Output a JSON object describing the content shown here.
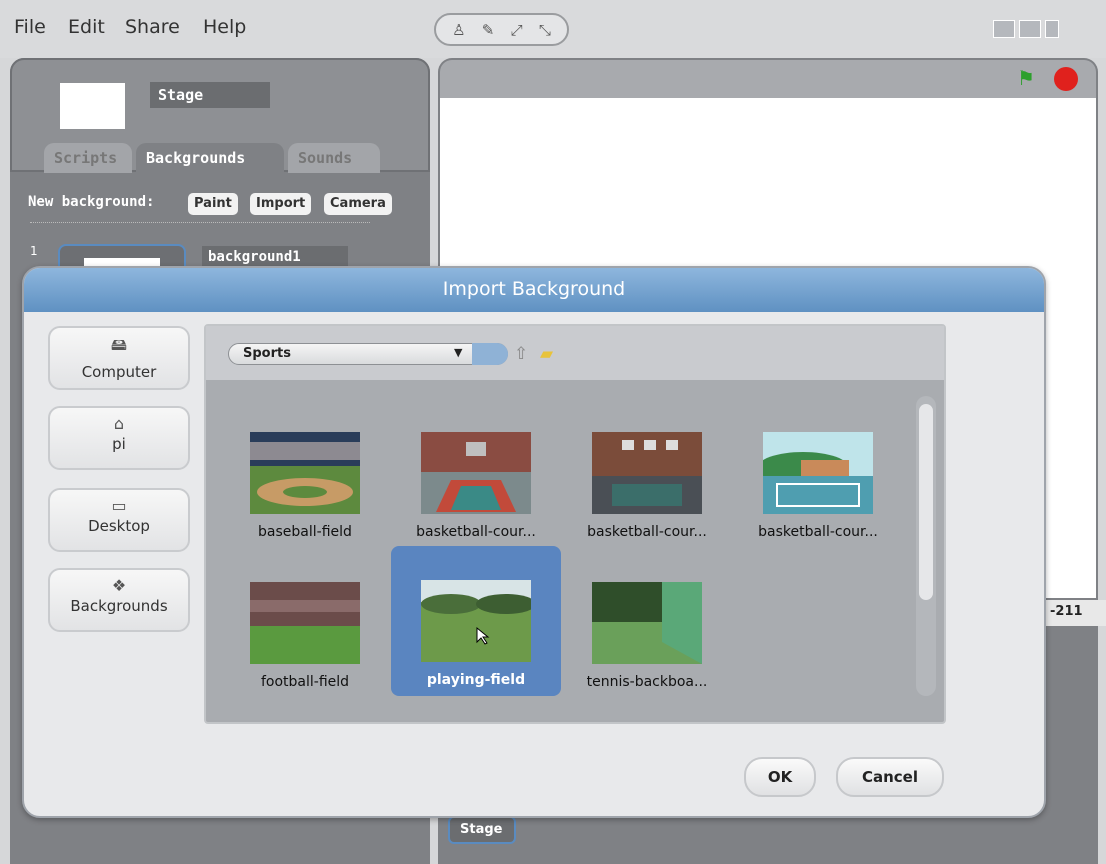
{
  "menu": [
    "File",
    "Edit",
    "Share",
    "Help"
  ],
  "toolbar_icons": [
    "person-icon",
    "wand-icon",
    "grow-icon",
    "shrink-icon"
  ],
  "sprite": {
    "name": "Stage"
  },
  "tabs": [
    "Scripts",
    "Backgrounds",
    "Sounds"
  ],
  "active_tab": "Backgrounds",
  "new_background": {
    "label": "New background:",
    "buttons": [
      "Paint",
      "Import",
      "Camera"
    ]
  },
  "background_list": [
    {
      "number": "1",
      "name": "background1"
    }
  ],
  "stage": {
    "coordinates": "-211",
    "stage_button": "Stage"
  },
  "dialog": {
    "title": "Import Background",
    "places": [
      "Computer",
      "pi",
      "Desktop",
      "Backgrounds"
    ],
    "folder": "Sports",
    "items": [
      {
        "label": "baseball-field",
        "selected": false
      },
      {
        "label": "basketball-cour...",
        "selected": false
      },
      {
        "label": "basketball-cour...",
        "selected": false
      },
      {
        "label": "basketball-cour...",
        "selected": false
      },
      {
        "label": "football-field",
        "selected": false
      },
      {
        "label": "playing-field",
        "selected": true
      },
      {
        "label": "tennis-backboa...",
        "selected": false
      }
    ],
    "ok": "OK",
    "cancel": "Cancel"
  },
  "colors": {
    "title_bar": "#6e9dcc",
    "selection": "#5a85c0",
    "stop": "#e0211d",
    "flag": "#2ca02c"
  }
}
